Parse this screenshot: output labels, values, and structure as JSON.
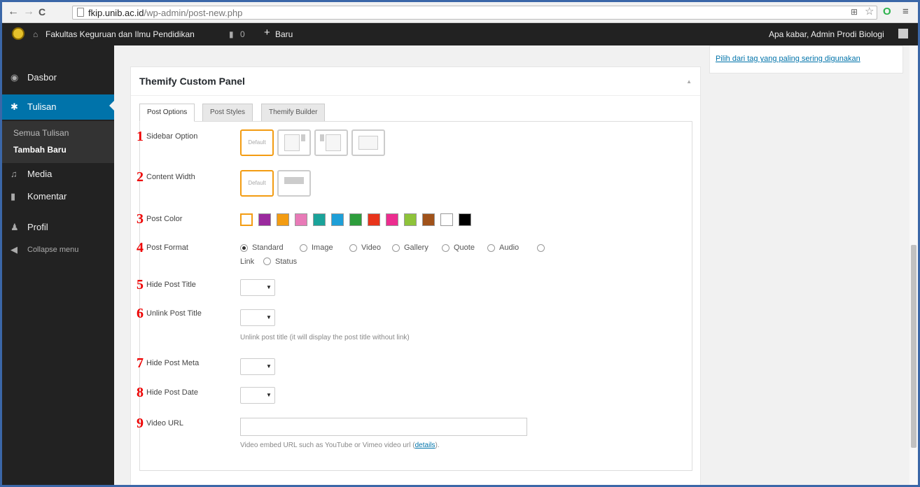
{
  "browser": {
    "url_host": "fkip.unib.ac.id",
    "url_path": "/wp-admin/post-new.php",
    "back_icon": "←",
    "forward_icon": "→",
    "reload_icon": "C",
    "star_icon": "☆",
    "menu_icon": "≡"
  },
  "adminbar": {
    "site_name": "Fakultas Keguruan dan Ilmu Pendidikan",
    "comments_count": "0",
    "new_label": "Baru",
    "greeting": "Apa kabar, Admin Prodi Biologi"
  },
  "sidebar": {
    "items": [
      {
        "label": "Dasbor",
        "icon": "dashboard-icon"
      },
      {
        "label": "Tulisan",
        "icon": "pin-icon"
      },
      {
        "label": "Media",
        "icon": "media-icon"
      },
      {
        "label": "Komentar",
        "icon": "comment-icon"
      },
      {
        "label": "Profil",
        "icon": "user-icon"
      },
      {
        "label": "Collapse menu",
        "icon": "collapse-icon"
      }
    ],
    "submenu": [
      "Semua Tulisan",
      "Tambah Baru"
    ]
  },
  "right_box": {
    "link": "Pilih dari tag yang paling sering digunakan"
  },
  "panel": {
    "title": "Themify Custom Panel",
    "tabs": [
      "Post Options",
      "Post Styles",
      "Themify Builder"
    ],
    "active_tab": "Post Options"
  },
  "options": {
    "sidebar_option": {
      "num": "1",
      "label": "Sidebar Option",
      "default_label": "Default"
    },
    "content_width": {
      "num": "2",
      "label": "Content Width",
      "default_label": "Default"
    },
    "post_color": {
      "num": "3",
      "label": "Post Color",
      "colors": [
        "#9b2a9e",
        "#f39c12",
        "#e87ab7",
        "#1aa39a",
        "#1e9fd8",
        "#2e9d3c",
        "#e8341b",
        "#ec2d8f",
        "#8ec33a",
        "#a0521a",
        "#ffffff",
        "#000000"
      ]
    },
    "post_format": {
      "num": "4",
      "label": "Post Format",
      "choices": [
        "Standard",
        "Image",
        "Video",
        "Gallery",
        "Quote",
        "Audio",
        "Link",
        "Status"
      ],
      "selected": "Standard"
    },
    "hide_post_title": {
      "num": "5",
      "label": "Hide Post Title"
    },
    "unlink_post_title": {
      "num": "6",
      "label": "Unlink Post Title",
      "help": "Unlink post title (it will display the post title without link)"
    },
    "hide_post_meta": {
      "num": "7",
      "label": "Hide Post Meta"
    },
    "hide_post_date": {
      "num": "8",
      "label": "Hide Post Date"
    },
    "video_url": {
      "num": "9",
      "label": "Video URL",
      "value": "",
      "help_text": "Video embed URL such as YouTube or Vimeo video url (",
      "help_link": "details",
      "help_end": ")."
    }
  }
}
